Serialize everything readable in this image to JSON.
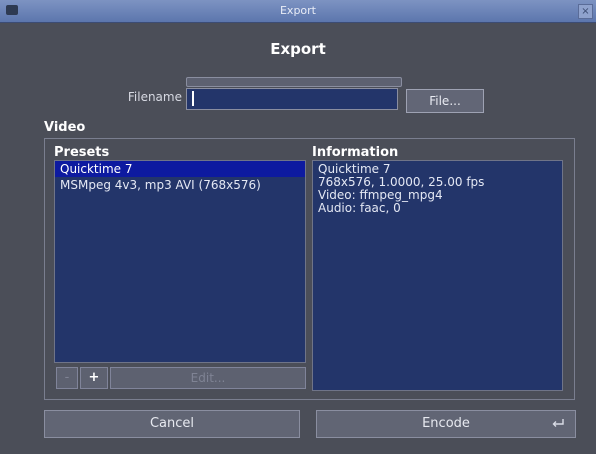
{
  "window": {
    "title": "Export",
    "close_glyph": "×"
  },
  "dialog": {
    "heading": "Export"
  },
  "filename": {
    "label": "Filename",
    "value": ""
  },
  "buttons": {
    "file": "File...",
    "cancel": "Cancel",
    "encode": "Encode",
    "remove": "-",
    "add": "+",
    "edit": "Edit..."
  },
  "video": {
    "label": "Video",
    "presets_title": "Presets",
    "information_title": "Information",
    "presets": [
      "Quicktime 7",
      "MSMpeg 4v3, mp3 AVI (768x576)"
    ],
    "information": [
      "Quicktime 7",
      "768x576, 1.0000, 25.00 fps",
      "Video: ffmpeg_mpg4",
      "Audio: faac, 0"
    ]
  },
  "icons": {
    "system_menu": "window-menu-icon",
    "enter": "enter-key-icon",
    "close": "close-icon"
  },
  "colors": {
    "titlebar": "#6a82b8",
    "list_background": "#23356a",
    "selection": "#0d1aa0",
    "window_background": "#4b4e58"
  }
}
